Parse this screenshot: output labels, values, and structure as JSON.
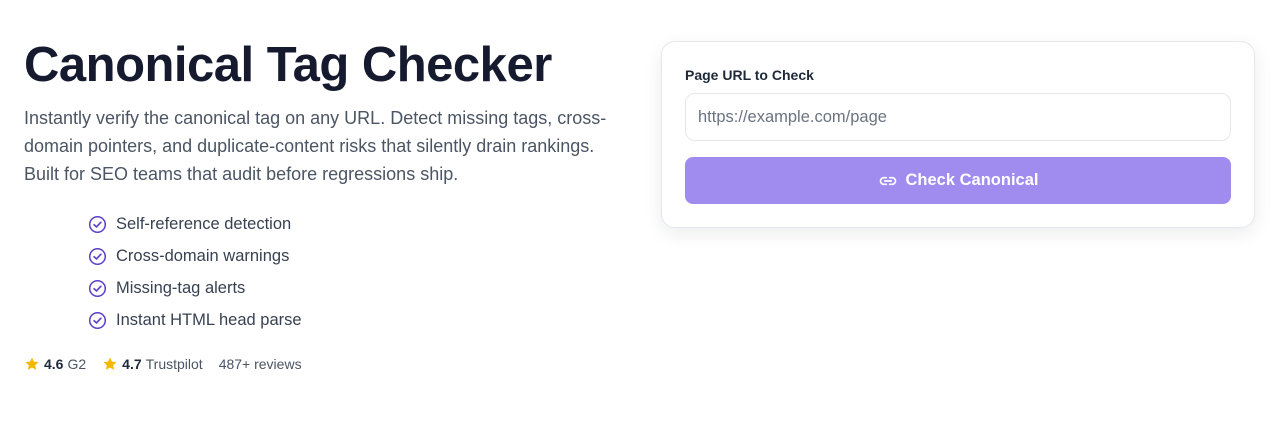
{
  "hero": {
    "title": "Canonical Tag Checker",
    "subtitle": "Instantly verify the canonical tag on any URL. Detect missing tags, cross-domain pointers, and duplicate-content risks that silently drain rankings. Built for SEO teams that audit before regressions ship."
  },
  "features": [
    {
      "label": "Self-reference detection",
      "icon": "check-circle-icon"
    },
    {
      "label": "Cross-domain warnings",
      "icon": "check-circle-icon"
    },
    {
      "label": "Missing-tag alerts",
      "icon": "check-circle-icon"
    },
    {
      "label": "Instant HTML head parse",
      "icon": "check-circle-icon"
    }
  ],
  "ratings": {
    "g2": {
      "score": "4.6",
      "source": "G2",
      "icon": "star-icon"
    },
    "trustpilot": {
      "score": "4.7",
      "source": "Trustpilot",
      "icon": "star-icon"
    },
    "reviews": "487+ reviews"
  },
  "form": {
    "label": "Page URL to Check",
    "input_value": "",
    "input_placeholder": "https://example.com/page",
    "button_label": "Check Canonical",
    "button_icon": "link-icon"
  },
  "colors": {
    "accent": "#a08bef",
    "check_icon": "#5b3fc4",
    "star": "#f5b800",
    "title": "#151a2e"
  }
}
